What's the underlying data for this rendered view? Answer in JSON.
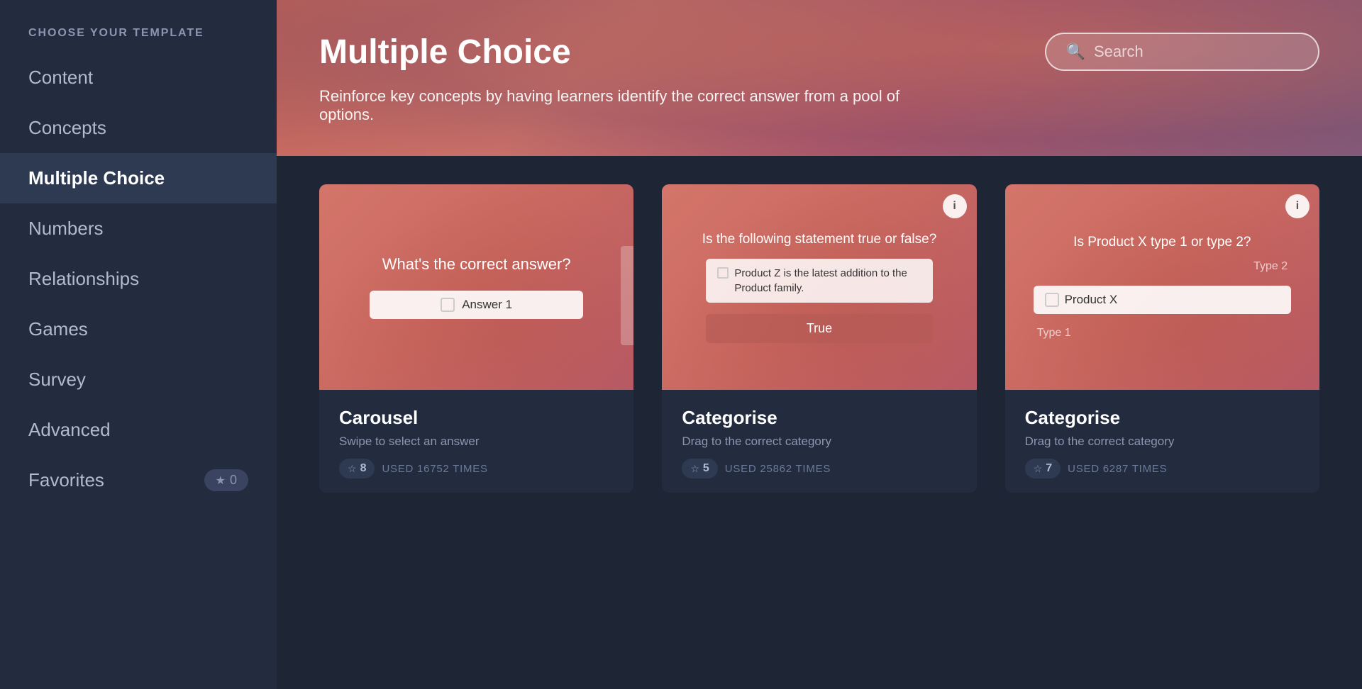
{
  "sidebar": {
    "header": "CHOOSE YOUR TEMPLATE",
    "items": [
      {
        "id": "content",
        "label": "Content",
        "active": false
      },
      {
        "id": "concepts",
        "label": "Concepts",
        "active": false
      },
      {
        "id": "multiple-choice",
        "label": "Multiple Choice",
        "active": true
      },
      {
        "id": "numbers",
        "label": "Numbers",
        "active": false
      },
      {
        "id": "relationships",
        "label": "Relationships",
        "active": false
      },
      {
        "id": "games",
        "label": "Games",
        "active": false
      },
      {
        "id": "survey",
        "label": "Survey",
        "active": false
      },
      {
        "id": "advanced",
        "label": "Advanced",
        "active": false
      }
    ],
    "favorites": {
      "label": "Favorites",
      "count": "0"
    }
  },
  "header": {
    "title": "Multiple Choice",
    "description": "Reinforce key concepts by having learners identify the correct answer from a pool of options.",
    "search_placeholder": "Search"
  },
  "cards": [
    {
      "id": "carousel",
      "title": "Carousel",
      "subtitle": "Swipe to select an answer",
      "rating": "8",
      "used_count": "USED 16752 TIMES",
      "preview_question": "What's the correct answer?",
      "preview_answer": "Answer 1",
      "info_visible": false
    },
    {
      "id": "categorise-1",
      "title": "Categorise",
      "subtitle": "Drag to the correct category",
      "rating": "5",
      "used_count": "USED 25862 TIMES",
      "preview_question": "Is the following statement true or false?",
      "preview_statement": "Product Z is the latest addition to the Product family.",
      "preview_true": "True",
      "info_visible": true
    },
    {
      "id": "categorise-2",
      "title": "Categorise",
      "subtitle": "Drag to the correct category",
      "rating": "7",
      "used_count": "USED 6287 TIMES",
      "preview_question": "Is Product X type 1 or type 2?",
      "preview_type2": "Type 2",
      "preview_product": "Product X",
      "preview_type1": "Type 1",
      "info_visible": true
    }
  ],
  "icons": {
    "search": "&#128269;",
    "star": "&#9733;",
    "info": "i"
  }
}
